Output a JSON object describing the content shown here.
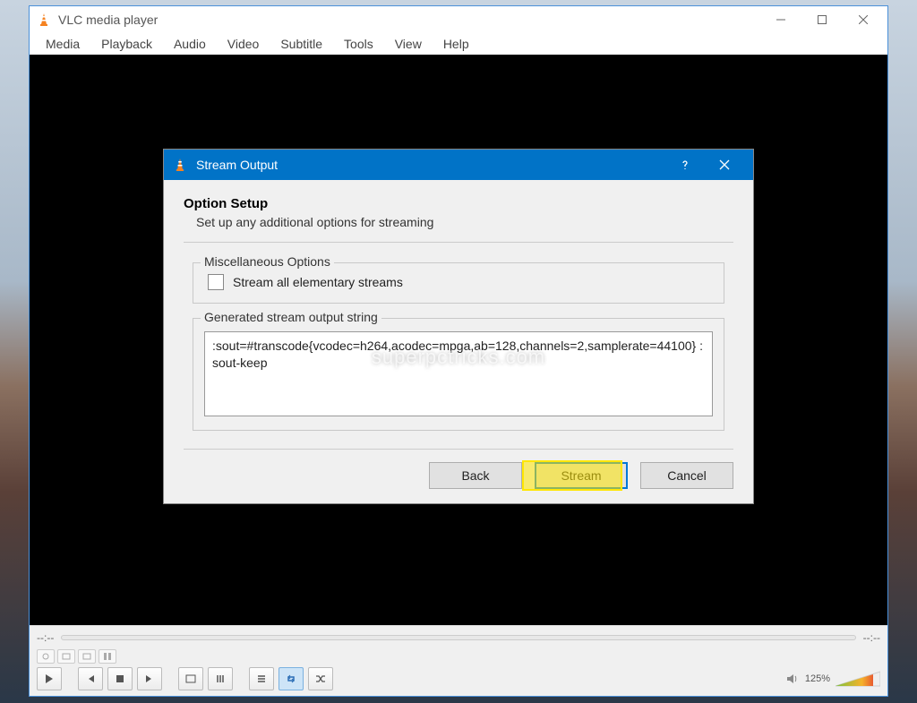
{
  "app": {
    "title": "VLC media player"
  },
  "menubar": [
    "Media",
    "Playback",
    "Audio",
    "Video",
    "Subtitle",
    "Tools",
    "View",
    "Help"
  ],
  "dialog": {
    "title": "Stream Output",
    "heading": "Option Setup",
    "subheading": "Set up any additional options for streaming",
    "misc_group_title": "Miscellaneous Options",
    "stream_all_label": "Stream all elementary streams",
    "stream_all_checked": false,
    "output_group_title": "Generated stream output string",
    "output_string": ":sout=#transcode{vcodec=h264,acodec=mpga,ab=128,channels=2,samplerate=44100} :sout-keep",
    "buttons": {
      "back": "Back",
      "stream": "Stream",
      "cancel": "Cancel"
    }
  },
  "player": {
    "time_left": "--:--",
    "time_right": "--:--",
    "volume_pct": "125%"
  },
  "watermark": "superpctricks.com"
}
